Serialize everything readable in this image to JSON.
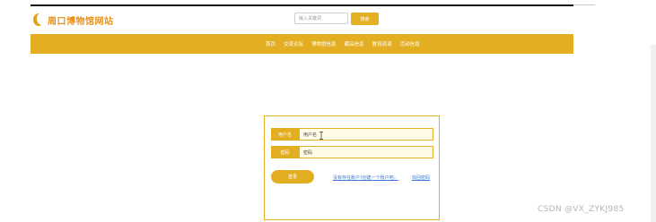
{
  "header": {
    "site_title": "周口博物馆网站",
    "logo_icon": "moon-icon"
  },
  "search": {
    "placeholder": "输入关键词",
    "button_label": "搜索"
  },
  "nav": {
    "items": [
      {
        "label": "首页"
      },
      {
        "label": "交流论坛"
      },
      {
        "label": "博物馆信息"
      },
      {
        "label": "藏品信息"
      },
      {
        "label": "教育资源"
      },
      {
        "label": "活动信息"
      }
    ]
  },
  "login": {
    "username_label": "用户名",
    "username_value": "用户名",
    "password_label": "密码",
    "password_value": "密码",
    "submit_label": "登录",
    "register_link": "没有存在账户?创建一个账户吧。",
    "forgot_link": "找回密码"
  },
  "watermark": "CSDN @VX_ZYKJ985",
  "colors": {
    "accent": "#E3AE22",
    "title": "#E8911A",
    "link": "#3A78D4",
    "input_bg": "#FFFBE6"
  }
}
